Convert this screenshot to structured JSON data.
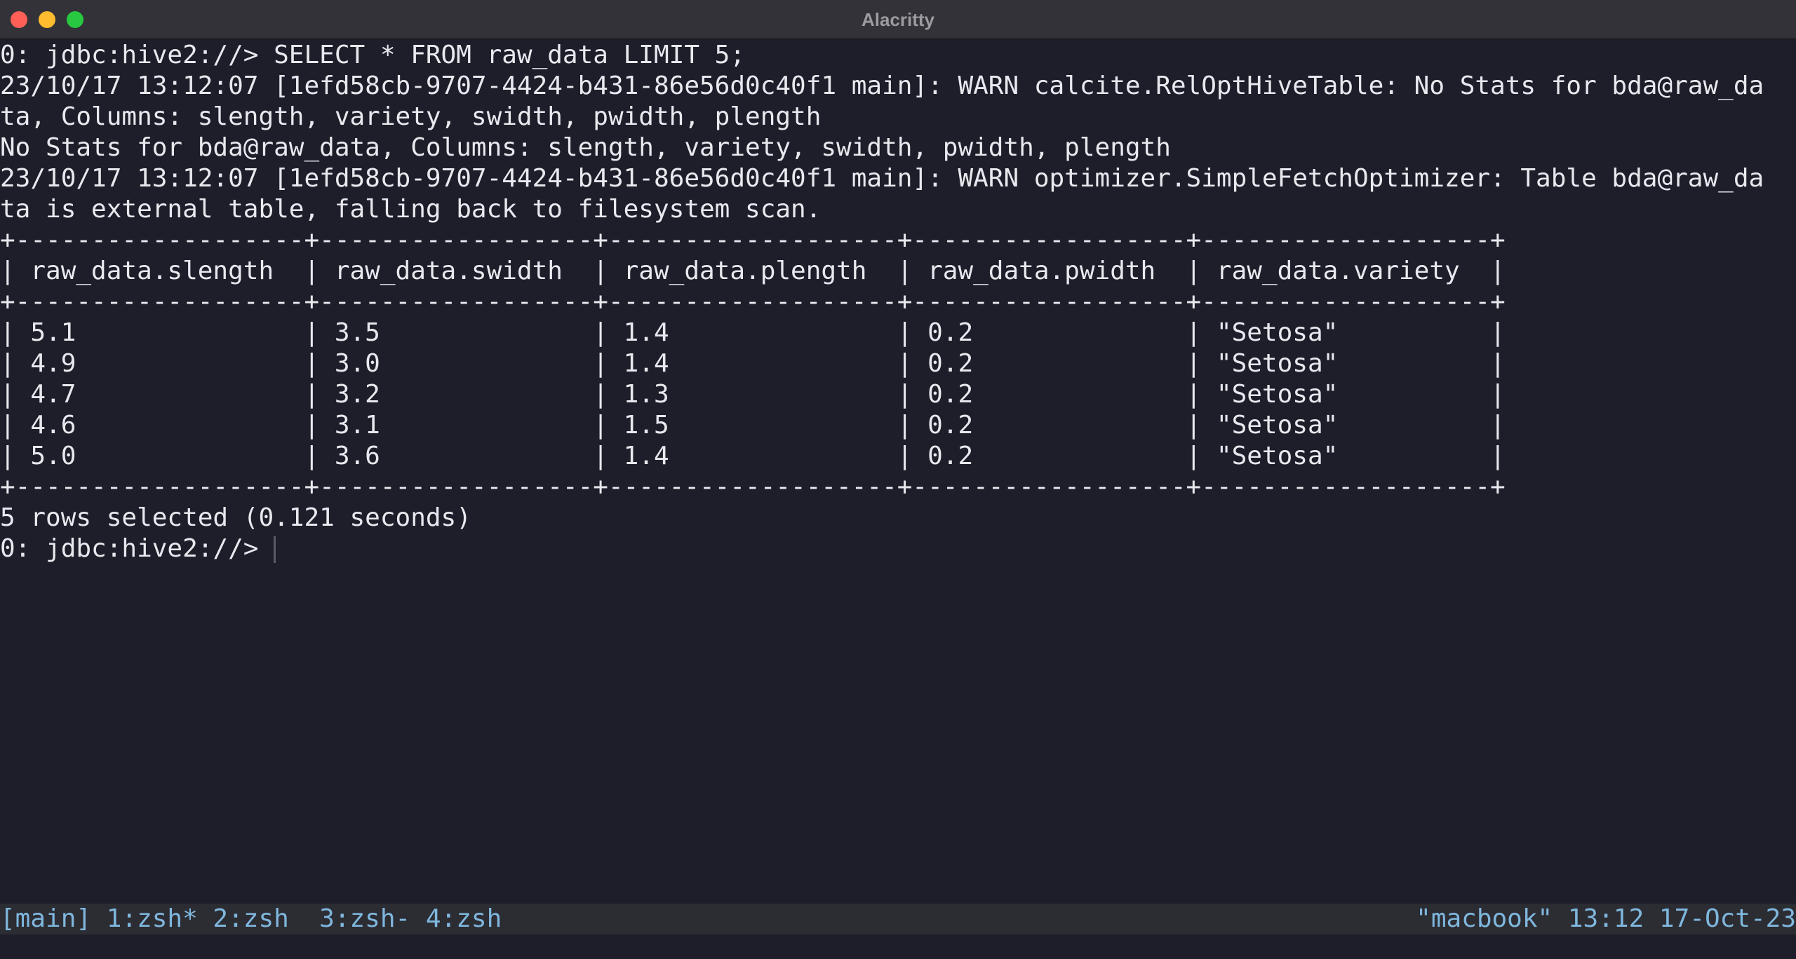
{
  "window": {
    "title": "Alacritty"
  },
  "terminal": {
    "lines": [
      "0: jdbc:hive2://> SELECT * FROM raw_data LIMIT 5;",
      "23/10/17 13:12:07 [1efd58cb-9707-4424-b431-86e56d0c40f1 main]: WARN calcite.RelOptHiveTable: No Stats for bda@raw_da",
      "ta, Columns: slength, variety, swidth, pwidth, plength",
      "No Stats for bda@raw_data, Columns: slength, variety, swidth, pwidth, plength",
      "23/10/17 13:12:07 [1efd58cb-9707-4424-b431-86e56d0c40f1 main]: WARN optimizer.SimpleFetchOptimizer: Table bda@raw_da",
      "ta is external table, falling back to filesystem scan.",
      "+-------------------+------------------+-------------------+------------------+-------------------+",
      "| raw_data.slength  | raw_data.swidth  | raw_data.plength  | raw_data.pwidth  | raw_data.variety  |",
      "+-------------------+------------------+-------------------+------------------+-------------------+",
      "| 5.1               | 3.5              | 1.4               | 0.2              | \"Setosa\"          |",
      "| 4.9               | 3.0              | 1.4               | 0.2              | \"Setosa\"          |",
      "| 4.7               | 3.2              | 1.3               | 0.2              | \"Setosa\"          |",
      "| 4.6               | 3.1              | 1.5               | 0.2              | \"Setosa\"          |",
      "| 5.0               | 3.6              | 1.4               | 0.2              | \"Setosa\"          |",
      "+-------------------+------------------+-------------------+------------------+-------------------+",
      "5 rows selected (0.121 seconds)"
    ],
    "prompt": "0: jdbc:hive2://> "
  },
  "tmux": {
    "left": "[main] 1:zsh* 2:zsh  3:zsh- 4:zsh",
    "right": "\"macbook\" 13:12 17-Oct-23"
  },
  "colors": {
    "background": "#1e1e2a",
    "foreground": "#e8e8ee",
    "status_text": "#7fb7dd",
    "status_bg": "#2c2c33"
  }
}
